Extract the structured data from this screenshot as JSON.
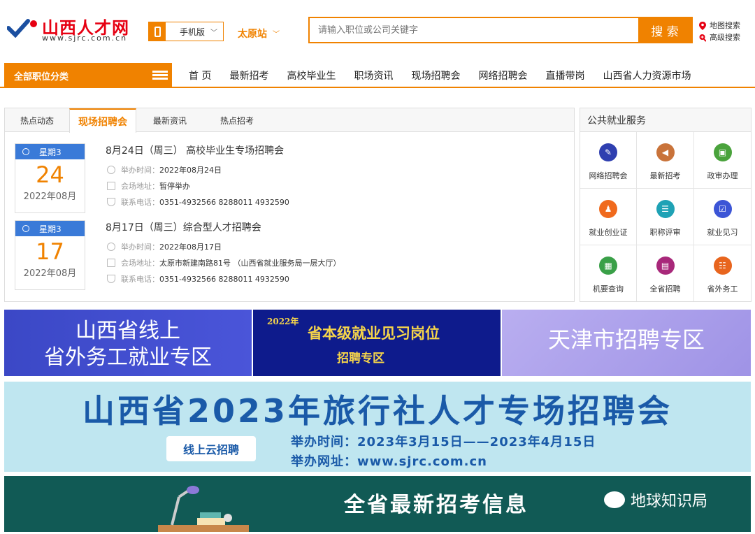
{
  "header": {
    "logo_cn": "山西人才网",
    "logo_en": "www.sjrc.com.cn",
    "mobile_label": "手机版",
    "city": "太原站",
    "search_placeholder": "请输入职位或公司关键字",
    "search_button": "搜 索",
    "map_search": "地图搜索",
    "advanced_search": "高级搜索"
  },
  "nav": {
    "categories": "全部职位分类",
    "items": [
      "首 页",
      "最新招考",
      "高校毕业生",
      "职场资讯",
      "现场招聘会",
      "网络招聘会",
      "直播带岗",
      "山西省人力资源市场"
    ]
  },
  "tabs": [
    "热点动态",
    "现场招聘会",
    "最新资讯",
    "热点招考"
  ],
  "events": [
    {
      "weekday": "星期3",
      "day": "24",
      "year_month": "2022年08月",
      "title": "8月24日（周三） 高校毕业生专场招聘会",
      "time_label": "举办时间：",
      "time": "2022年08月24日",
      "addr_label": "会场地址：",
      "addr": "暂停举办",
      "phone_label": "联系电话：",
      "phone": "0351-4932566 8288011 4932590"
    },
    {
      "weekday": "星期3",
      "day": "17",
      "year_month": "2022年08月",
      "title": "8月17日（周三）综合型人才招聘会",
      "time_label": "举办时间：",
      "time": "2022年08月17日",
      "addr_label": "会场地址：",
      "addr": "太原市新建南路81号 （山西省就业服务局一层大厅）",
      "phone_label": "联系电话：",
      "phone": "0351-4932566 8288011 4932590"
    }
  ],
  "service": {
    "title": "公共就业服务",
    "items": [
      {
        "label": "网络招聘会",
        "icon": "checklist-icon",
        "color": "#2f3fb0"
      },
      {
        "label": "最新招考",
        "icon": "megaphone-icon",
        "color": "#c9733a"
      },
      {
        "label": "政审办理",
        "icon": "document-icon",
        "color": "#4aa33c"
      },
      {
        "label": "就业创业证",
        "icon": "person-icon",
        "color": "#f06a1d"
      },
      {
        "label": "职称评审",
        "icon": "certificate-icon",
        "color": "#1fa2b5"
      },
      {
        "label": "就业见习",
        "icon": "checkbox-icon",
        "color": "#3c55d6"
      },
      {
        "label": "机要查询",
        "icon": "grid-icon",
        "color": "#3aa048"
      },
      {
        "label": "全省招聘",
        "icon": "calculator-icon",
        "color": "#a8287a"
      },
      {
        "label": "省外务工",
        "icon": "people-icon",
        "color": "#e8651e"
      }
    ]
  },
  "banners": {
    "b1_line1": "山西省线上",
    "b1_line2": "省外务工就业专区",
    "b2_year": "2022年",
    "b2_line1": "省本级就业见习岗位",
    "b2_line2": "招聘专区",
    "b3": "天津市招聘专区",
    "b4_title": "山西省2023年旅行社人才专场招聘会",
    "b4_tag": "线上云招聘",
    "b4_time": "举办时间：2023年3月15日——2023年4月15日",
    "b4_site": "举办网址：www.sjrc.com.cn",
    "b5_title": "全省最新招考信息",
    "b5_watermark": "地球知识局"
  },
  "colors": {
    "accent": "#f08200",
    "date_blue": "#3a7ad8"
  }
}
